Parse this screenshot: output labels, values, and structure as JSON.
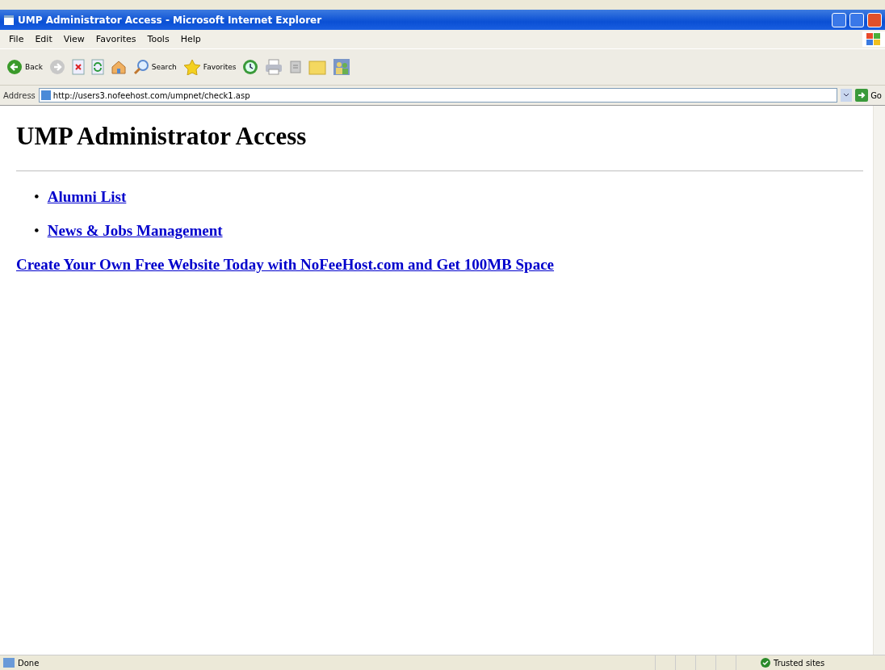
{
  "window": {
    "title": "UMP Administrator Access - Microsoft Internet Explorer"
  },
  "menu": [
    "File",
    "Edit",
    "View",
    "Favorites",
    "Tools",
    "Help"
  ],
  "toolbar": [
    {
      "kind": "back",
      "label": "Back"
    },
    {
      "kind": "forward"
    },
    {
      "kind": "stop"
    },
    {
      "kind": "refresh"
    },
    {
      "kind": "home"
    },
    {
      "kind": "search",
      "label": "Search"
    },
    {
      "kind": "favorites",
      "label": "Favorites"
    },
    {
      "kind": "history"
    },
    {
      "kind": "print"
    },
    {
      "kind": "edit"
    },
    {
      "kind": "folder"
    },
    {
      "kind": "messenger"
    }
  ],
  "address": {
    "label": "Address",
    "value": "http://users3.nofeehost.com/umpnet/check1.asp",
    "go": "Go"
  },
  "page": {
    "heading": "UMP Administrator Access",
    "links": [
      {
        "marker": "•",
        "label": "Alumni List"
      },
      {
        "marker": "•",
        "label": "News & Jobs Management"
      }
    ],
    "footer_link": "Create Your Own Free Website Today with NoFeeHost.com and Get 100MB Space"
  },
  "status_bar": {
    "text": "Done",
    "zone": "Trusted sites"
  }
}
